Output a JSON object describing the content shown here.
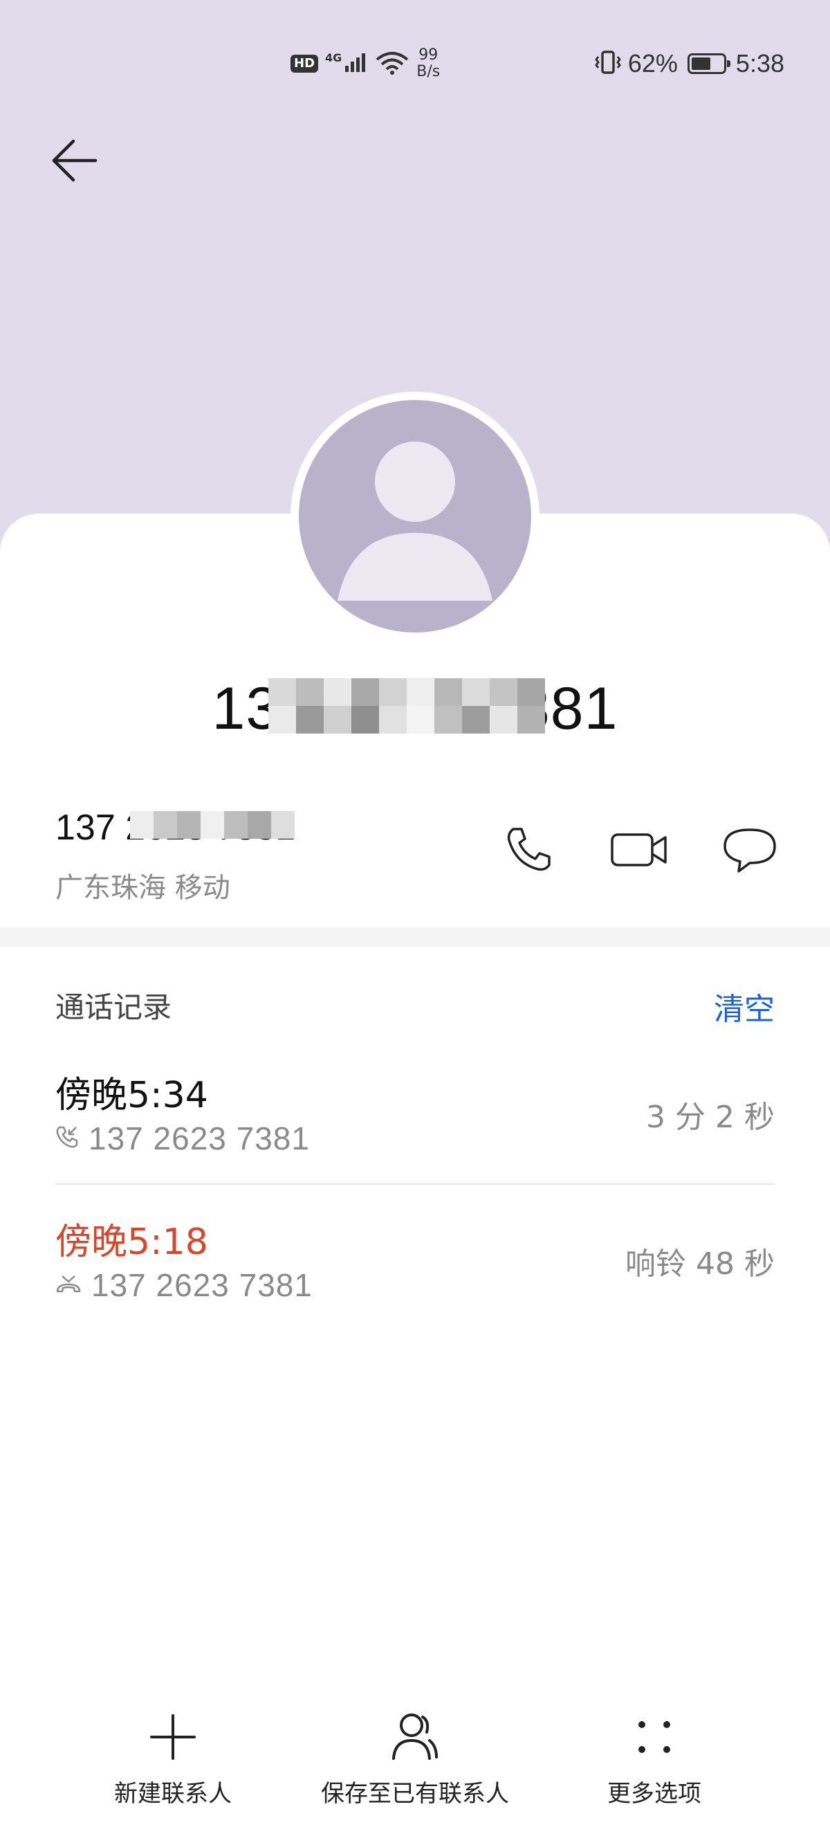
{
  "status_bar": {
    "hd": "HD",
    "network": "4G",
    "speed_value": "99",
    "speed_unit": "B/s",
    "battery_percent": "62%",
    "battery_level": 0.62,
    "time": "5:38"
  },
  "header": {
    "back_icon": "back-arrow-icon",
    "background_color": "#e1dbec"
  },
  "contact": {
    "avatar_icon": "person-icon",
    "title_number": "137 2623 7381",
    "phone_number": "137 2623 7381",
    "location": "广东珠海 移动",
    "actions": [
      {
        "icon": "phone-icon"
      },
      {
        "icon": "video-call-icon"
      },
      {
        "icon": "message-icon"
      }
    ]
  },
  "call_log": {
    "title": "通话记录",
    "clear_label": "清空",
    "accent_color": "#1a62d6",
    "missed_color": "#d8462b",
    "entries": [
      {
        "time": "傍晚5:34",
        "type_icon": "incoming-call-icon",
        "number": "137 2623 7381",
        "duration": "3 分 2 秒",
        "missed": false
      },
      {
        "time": "傍晚5:18",
        "type_icon": "missed-call-icon",
        "number": "137 2623 7381",
        "duration": "响铃 48 秒",
        "missed": true
      }
    ]
  },
  "toolbar": {
    "new_contact_label": "新建联系人",
    "save_existing_label": "保存至已有联系人",
    "more_options_label": "更多选项"
  }
}
